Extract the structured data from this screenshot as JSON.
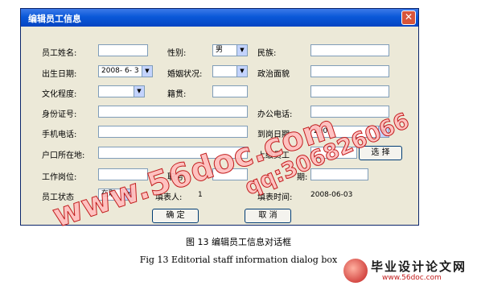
{
  "window": {
    "title": "编辑员工信息",
    "close_glyph": "✕"
  },
  "form": {
    "employee_name_label": "员工姓名:",
    "gender_label": "性别:",
    "gender_value": "男",
    "ethnicity_label": "民族:",
    "birth_date_label": "出生日期:",
    "birth_date_value": "2008- 6- 3",
    "marital_label": "婚姻状况:",
    "political_label": "政治面貌",
    "education_label": "文化程度:",
    "native_place_label": "籍贯:",
    "id_number_label": "身份证号:",
    "office_phone_label": "办公电话:",
    "mobile_label": "手机电话:",
    "hire_date_label": "到岗日期:",
    "hire_date_value": "200",
    "household_label": "户口所在地:",
    "supervisor_label": "上级员工",
    "select_button": "选 择",
    "position_label": "工作岗位:",
    "title_label": "职务:",
    "date_partial_label": "期:",
    "status_label": "员工状态",
    "status_value": "在职",
    "filler_label": "填表人:",
    "filler_value": "1",
    "fill_time_label": "填表时间:",
    "fill_time_value": "2008-06-03"
  },
  "buttons": {
    "ok": "确 定",
    "cancel": "取 消"
  },
  "watermark": {
    "domain": "www.56doc.com",
    "qq": "qq:306826066"
  },
  "caption": {
    "chinese": "图 13  编辑员工信息对话框",
    "english": "Fig 13 Editorial staff information dialog box"
  },
  "logo": {
    "title": "毕业设计论文网",
    "url": "www.56doc.com"
  },
  "icons": {
    "dropdown": "dropdown-arrow-icon"
  }
}
